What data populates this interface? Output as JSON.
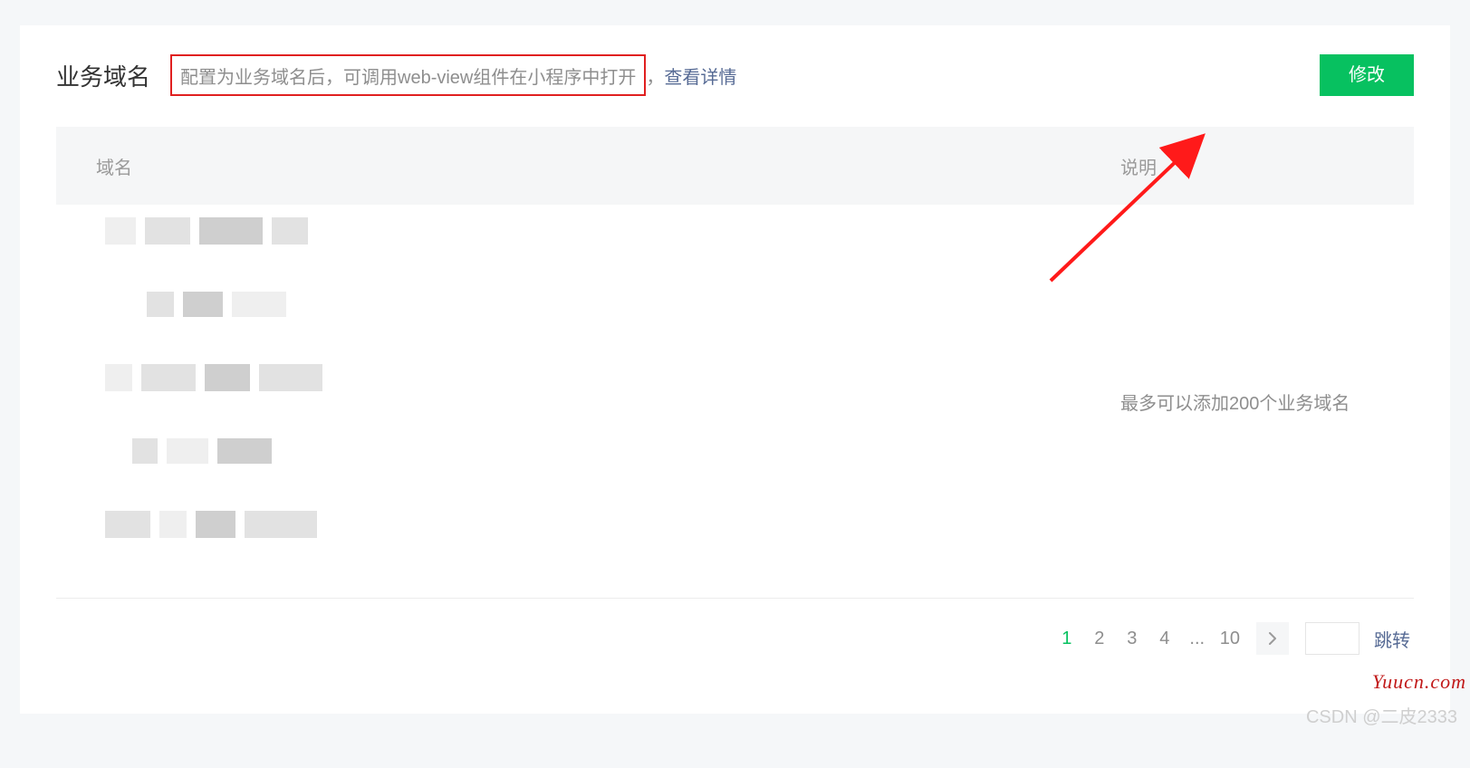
{
  "header": {
    "title": "业务域名",
    "description": "配置为业务域名后，可调用web-view组件在小程序中打开",
    "detail_punct": "，",
    "detail_link": "查看详情",
    "modify_btn": "修改"
  },
  "table": {
    "col_domain": "域名",
    "col_desc": "说明",
    "note": "最多可以添加200个业务域名"
  },
  "pagination": {
    "pages": [
      "1",
      "2",
      "3",
      "4",
      "...",
      "10"
    ],
    "active_index": 0,
    "jump_label": "跳转"
  },
  "watermark": {
    "yuucn": "Yuucn.com",
    "csdn": "CSDN @二皮2333"
  }
}
